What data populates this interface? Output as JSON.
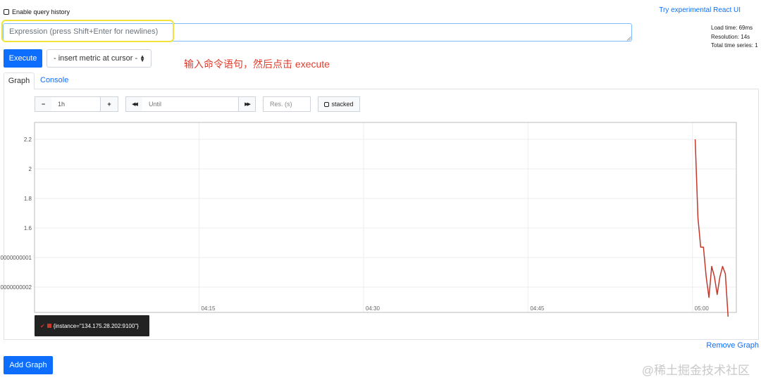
{
  "header": {
    "history_label": "Enable query history",
    "react_link": "Try experimental React UI"
  },
  "query": {
    "placeholder": "Expression (press Shift+Enter for newlines)",
    "value": ""
  },
  "stats": {
    "load_time": "Load time: 69ms",
    "resolution": "Resolution: 14s",
    "total_series": "Total time series: 1"
  },
  "toolbar": {
    "execute_label": "Execute",
    "metric_select": "- insert metric at cursor -"
  },
  "annotation": "输入命令语句，然后点击 execute",
  "tabs": [
    {
      "label": "Graph",
      "active": true
    },
    {
      "label": "Console",
      "active": false
    }
  ],
  "controls": {
    "minus": "−",
    "range": "1h",
    "plus": "+",
    "back": "◀◀",
    "until_placeholder": "Until",
    "forward": "▶▶",
    "res_placeholder": "Res. (s)",
    "stacked": "stacked"
  },
  "chart_data": {
    "type": "line",
    "x_ticks": [
      "04:15",
      "04:30",
      "04:45",
      "05:00"
    ],
    "y_ticks": [
      "2.2",
      "2",
      "1.8",
      "1.6",
      "0000000001",
      "0000000002"
    ],
    "series": [
      {
        "name": "{instance=\"134.175.28.202:9100\"}",
        "color": "#c0392b",
        "points": [
          [
            "05:00:15",
            2.2
          ],
          [
            "05:00:30",
            1.67
          ],
          [
            "05:00:45",
            1.47
          ],
          [
            "05:01:00",
            1.47
          ],
          [
            "05:01:15",
            1.27
          ],
          [
            "05:01:30",
            1.13
          ],
          [
            "05:01:45",
            1.34
          ],
          [
            "05:02:00",
            1.27
          ],
          [
            "05:02:15",
            1.15
          ],
          [
            "05:02:30",
            1.27
          ],
          [
            "05:02:45",
            1.34
          ],
          [
            "05:03:00",
            1.29
          ],
          [
            "05:03:15",
            1.0
          ]
        ]
      }
    ]
  },
  "footer": {
    "remove_graph": "Remove Graph",
    "add_graph": "Add Graph",
    "watermark": "@稀土掘金技术社区"
  }
}
